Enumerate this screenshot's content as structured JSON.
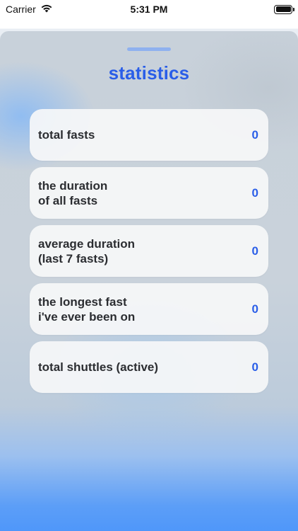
{
  "status_bar": {
    "carrier": "Carrier",
    "time": "5:31 PM",
    "icons": [
      "wifi-icon",
      "battery-icon"
    ]
  },
  "sheet": {
    "title": "statistics",
    "accent_color": "#2a5ee8",
    "stats": [
      {
        "label": "total fasts",
        "value": "0"
      },
      {
        "label": "the duration\nof all fasts",
        "value": "0"
      },
      {
        "label": "average duration\n(last 7 fasts)",
        "value": "0"
      },
      {
        "label": "the longest fast\ni've ever been on",
        "value": "0"
      },
      {
        "label": "total shuttles (active)",
        "value": "0"
      }
    ]
  }
}
